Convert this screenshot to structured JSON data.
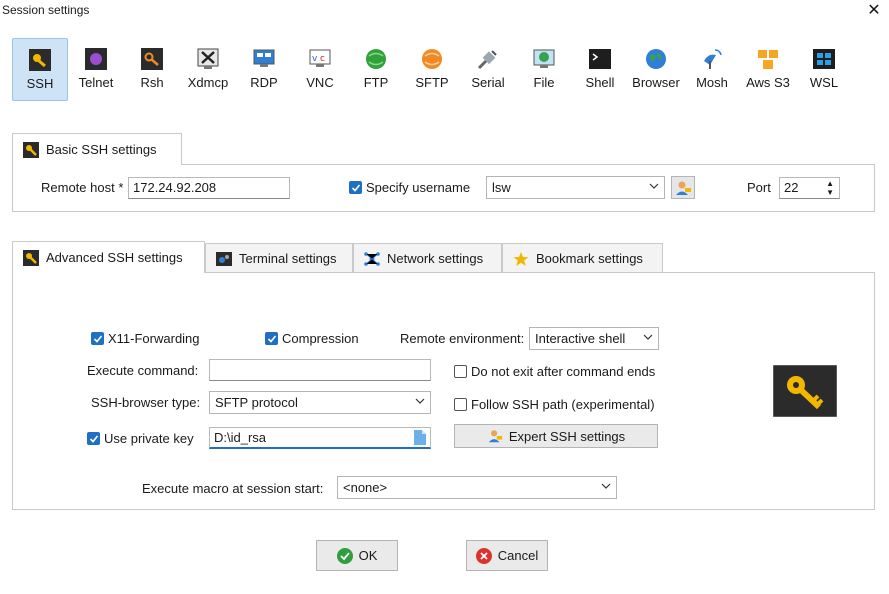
{
  "window": {
    "title": "Session settings"
  },
  "protocols": [
    {
      "label": "SSH",
      "icon": "ssh-icon",
      "selected": true
    },
    {
      "label": "Telnet",
      "icon": "telnet-icon"
    },
    {
      "label": "Rsh",
      "icon": "rsh-icon"
    },
    {
      "label": "Xdmcp",
      "icon": "xdmcp-icon"
    },
    {
      "label": "RDP",
      "icon": "rdp-icon"
    },
    {
      "label": "VNC",
      "icon": "vnc-icon"
    },
    {
      "label": "FTP",
      "icon": "ftp-icon"
    },
    {
      "label": "SFTP",
      "icon": "sftp-icon"
    },
    {
      "label": "Serial",
      "icon": "serial-icon"
    },
    {
      "label": "File",
      "icon": "file-icon"
    },
    {
      "label": "Shell",
      "icon": "shell-icon"
    },
    {
      "label": "Browser",
      "icon": "browser-icon"
    },
    {
      "label": "Mosh",
      "icon": "mosh-icon"
    },
    {
      "label": "Aws S3",
      "icon": "aws-s3-icon"
    },
    {
      "label": "WSL",
      "icon": "wsl-icon"
    }
  ],
  "basic": {
    "tab_label": "Basic SSH settings",
    "remote_host_label": "Remote host *",
    "remote_host_value": "172.24.92.208",
    "specify_username_label": "Specify username",
    "username_value": "lsw",
    "port_label": "Port",
    "port_value": "22"
  },
  "advanced_tabs": {
    "advanced": "Advanced SSH settings",
    "terminal": "Terminal settings",
    "network": "Network settings",
    "bookmark": "Bookmark settings"
  },
  "advanced": {
    "x11_label": "X11-Forwarding",
    "compression_label": "Compression",
    "remote_env_label": "Remote environment:",
    "remote_env_value": "Interactive shell",
    "exec_cmd_label": "Execute command:",
    "exec_cmd_value": "",
    "no_exit_label": "Do not exit after command ends",
    "browser_type_label": "SSH-browser type:",
    "browser_type_value": "SFTP protocol",
    "follow_path_label": "Follow SSH path (experimental)",
    "private_key_label": "Use private key",
    "private_key_value": "D:\\id_rsa",
    "expert_button": "Expert SSH settings",
    "macro_label": "Execute macro at session start:",
    "macro_value": "<none>"
  },
  "footer": {
    "ok": "OK",
    "cancel": "Cancel"
  },
  "colors": {
    "selected_bg": "#cfe3f7",
    "checkbox": "#1f6fc4",
    "ok_green": "#2e9e3e",
    "cancel_red": "#d9342b"
  }
}
